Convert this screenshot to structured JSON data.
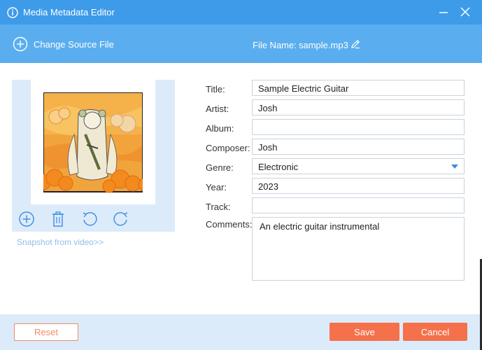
{
  "window": {
    "title": "Media Metadata Editor",
    "minimize_icon": "minimize-icon",
    "close_icon": "close-icon",
    "info_icon": "info-icon"
  },
  "toolbar": {
    "change_source_label": "Change Source File",
    "file_name_label": "File Name:",
    "file_name_value": "sample.mp3",
    "edit_icon": "pencil-icon"
  },
  "cover": {
    "tools": [
      "add-icon",
      "trash-icon",
      "rotate-left-icon",
      "rotate-right-icon"
    ],
    "snapshot_link": "Snapshot from video>>"
  },
  "fields": {
    "title_label": "Title:",
    "title_value": "Sample Electric Guitar",
    "artist_label": "Artist:",
    "artist_value": "Josh",
    "album_label": "Album:",
    "album_value": "",
    "composer_label": "Composer:",
    "composer_value": "Josh",
    "genre_label": "Genre:",
    "genre_value": "Electronic",
    "year_label": "Year:",
    "year_value": "2023",
    "track_label": "Track:",
    "track_value": "",
    "comments_label": "Comments:",
    "comments_value": "An electric guitar instrumental"
  },
  "footer": {
    "reset_label": "Reset",
    "save_label": "Save",
    "cancel_label": "Cancel"
  },
  "colors": {
    "titlebar": "#3d9be9",
    "toolbar": "#5aaeef",
    "accent": "#f4714c",
    "panel": "#dcebf9"
  }
}
